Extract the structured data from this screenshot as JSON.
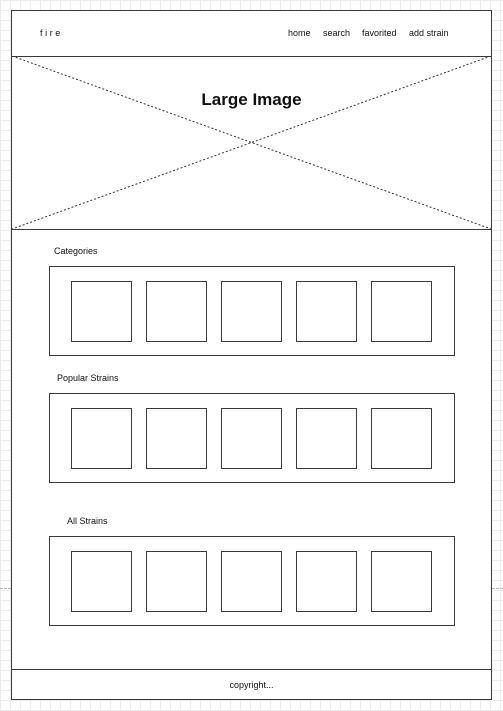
{
  "header": {
    "brand": "fire",
    "nav": [
      {
        "label": "home"
      },
      {
        "label": "search"
      },
      {
        "label": "favorited"
      },
      {
        "label": "add strain"
      }
    ]
  },
  "hero": {
    "title": "Large Image"
  },
  "sections": [
    {
      "label": "Categories",
      "tile_count": 5
    },
    {
      "label": "Popular Strains",
      "tile_count": 5
    },
    {
      "label": "All Strains",
      "tile_count": 5
    }
  ],
  "footer": {
    "text": "copyright..."
  }
}
